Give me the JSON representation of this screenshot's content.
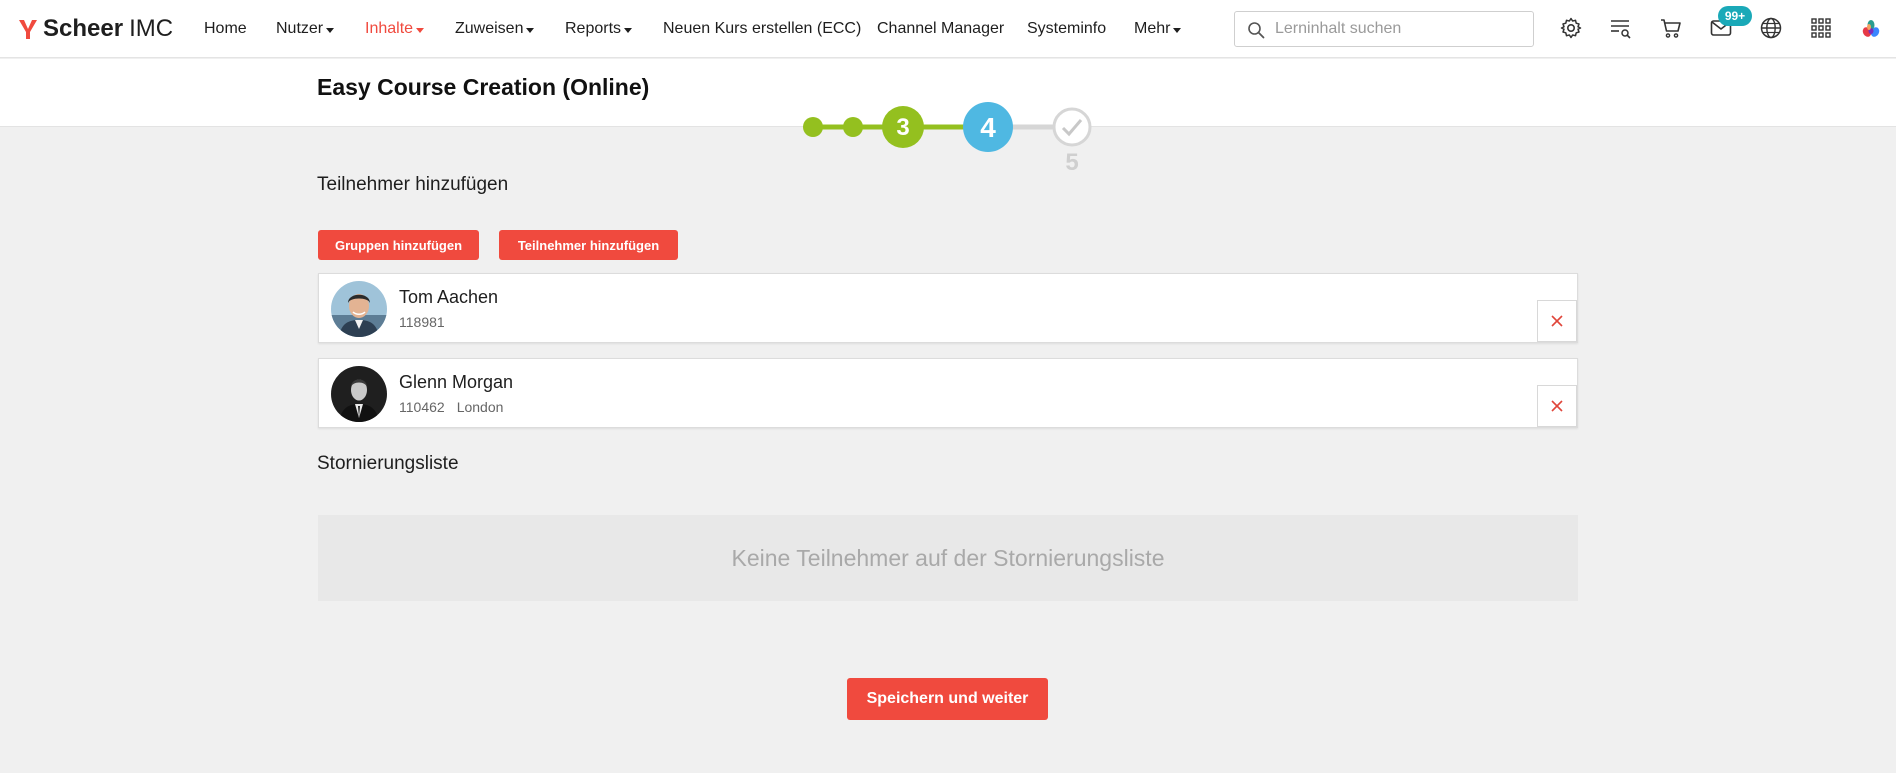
{
  "app": {
    "brand_bold": "Scheer",
    "brand_regular": "IMC",
    "brand_color": "#f04a3e"
  },
  "nav": {
    "items": [
      {
        "label": "Home",
        "dropdown": false,
        "active": false
      },
      {
        "label": "Nutzer",
        "dropdown": true,
        "active": false
      },
      {
        "label": "Inhalte",
        "dropdown": true,
        "active": true
      },
      {
        "label": "Zuweisen",
        "dropdown": true,
        "active": false
      },
      {
        "label": "Reports",
        "dropdown": true,
        "active": false
      },
      {
        "label": "Neuen Kurs erstellen (ECC)",
        "dropdown": false,
        "active": false
      },
      {
        "label": "Channel Manager",
        "dropdown": false,
        "active": false
      },
      {
        "label": "Systeminfo",
        "dropdown": false,
        "active": false
      },
      {
        "label": "Mehr",
        "dropdown": true,
        "active": false
      }
    ]
  },
  "search": {
    "placeholder": "Lerninhalt suchen",
    "value": ""
  },
  "toolbar": {
    "icons": [
      "gear-icon",
      "list-search-icon",
      "cart-icon",
      "mail-icon",
      "globe-icon",
      "apps-grid-icon",
      "partner-logo-icon"
    ],
    "mail_badge": "99+"
  },
  "page": {
    "title": "Easy Course Creation (Online)"
  },
  "stepper": {
    "steps": [
      {
        "label": "",
        "state": "done"
      },
      {
        "label": "",
        "state": "done"
      },
      {
        "label": "3",
        "state": "done"
      },
      {
        "label": "4",
        "state": "current"
      },
      {
        "label": "5",
        "state": "pending"
      }
    ],
    "colors": {
      "done": "#94c01f",
      "current": "#4fb8e2",
      "pending": "#d6d6d6"
    }
  },
  "participants": {
    "heading": "Teilnehmer hinzufügen",
    "add_groups_label": "Gruppen hinzufügen",
    "add_participants_label": "Teilnehmer hinzufügen",
    "list": [
      {
        "name": "Tom Aachen",
        "id": "118981",
        "location": ""
      },
      {
        "name": "Glenn Morgan",
        "id": "110462",
        "location": "London"
      }
    ]
  },
  "cancellation": {
    "heading": "Stornierungsliste",
    "empty_text": "Keine Teilnehmer auf der Stornierungsliste"
  },
  "footer": {
    "save_label": "Speichern und weiter"
  }
}
